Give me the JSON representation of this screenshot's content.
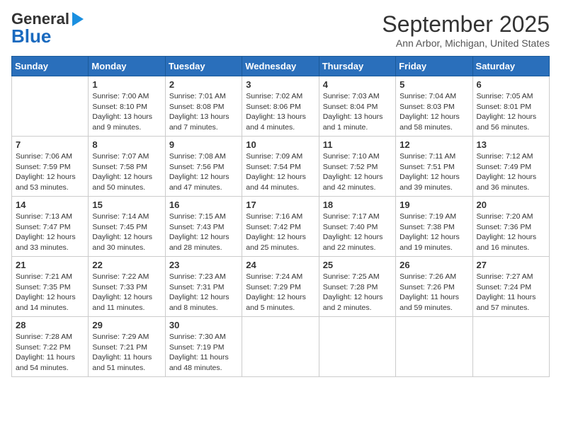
{
  "logo": {
    "line1": "General",
    "line2": "Blue"
  },
  "title": "September 2025",
  "subtitle": "Ann Arbor, Michigan, United States",
  "days_of_week": [
    "Sunday",
    "Monday",
    "Tuesday",
    "Wednesday",
    "Thursday",
    "Friday",
    "Saturday"
  ],
  "weeks": [
    [
      {
        "num": "",
        "info": ""
      },
      {
        "num": "1",
        "info": "Sunrise: 7:00 AM\nSunset: 8:10 PM\nDaylight: 13 hours\nand 9 minutes."
      },
      {
        "num": "2",
        "info": "Sunrise: 7:01 AM\nSunset: 8:08 PM\nDaylight: 13 hours\nand 7 minutes."
      },
      {
        "num": "3",
        "info": "Sunrise: 7:02 AM\nSunset: 8:06 PM\nDaylight: 13 hours\nand 4 minutes."
      },
      {
        "num": "4",
        "info": "Sunrise: 7:03 AM\nSunset: 8:04 PM\nDaylight: 13 hours\nand 1 minute."
      },
      {
        "num": "5",
        "info": "Sunrise: 7:04 AM\nSunset: 8:03 PM\nDaylight: 12 hours\nand 58 minutes."
      },
      {
        "num": "6",
        "info": "Sunrise: 7:05 AM\nSunset: 8:01 PM\nDaylight: 12 hours\nand 56 minutes."
      }
    ],
    [
      {
        "num": "7",
        "info": "Sunrise: 7:06 AM\nSunset: 7:59 PM\nDaylight: 12 hours\nand 53 minutes."
      },
      {
        "num": "8",
        "info": "Sunrise: 7:07 AM\nSunset: 7:58 PM\nDaylight: 12 hours\nand 50 minutes."
      },
      {
        "num": "9",
        "info": "Sunrise: 7:08 AM\nSunset: 7:56 PM\nDaylight: 12 hours\nand 47 minutes."
      },
      {
        "num": "10",
        "info": "Sunrise: 7:09 AM\nSunset: 7:54 PM\nDaylight: 12 hours\nand 44 minutes."
      },
      {
        "num": "11",
        "info": "Sunrise: 7:10 AM\nSunset: 7:52 PM\nDaylight: 12 hours\nand 42 minutes."
      },
      {
        "num": "12",
        "info": "Sunrise: 7:11 AM\nSunset: 7:51 PM\nDaylight: 12 hours\nand 39 minutes."
      },
      {
        "num": "13",
        "info": "Sunrise: 7:12 AM\nSunset: 7:49 PM\nDaylight: 12 hours\nand 36 minutes."
      }
    ],
    [
      {
        "num": "14",
        "info": "Sunrise: 7:13 AM\nSunset: 7:47 PM\nDaylight: 12 hours\nand 33 minutes."
      },
      {
        "num": "15",
        "info": "Sunrise: 7:14 AM\nSunset: 7:45 PM\nDaylight: 12 hours\nand 30 minutes."
      },
      {
        "num": "16",
        "info": "Sunrise: 7:15 AM\nSunset: 7:43 PM\nDaylight: 12 hours\nand 28 minutes."
      },
      {
        "num": "17",
        "info": "Sunrise: 7:16 AM\nSunset: 7:42 PM\nDaylight: 12 hours\nand 25 minutes."
      },
      {
        "num": "18",
        "info": "Sunrise: 7:17 AM\nSunset: 7:40 PM\nDaylight: 12 hours\nand 22 minutes."
      },
      {
        "num": "19",
        "info": "Sunrise: 7:19 AM\nSunset: 7:38 PM\nDaylight: 12 hours\nand 19 minutes."
      },
      {
        "num": "20",
        "info": "Sunrise: 7:20 AM\nSunset: 7:36 PM\nDaylight: 12 hours\nand 16 minutes."
      }
    ],
    [
      {
        "num": "21",
        "info": "Sunrise: 7:21 AM\nSunset: 7:35 PM\nDaylight: 12 hours\nand 14 minutes."
      },
      {
        "num": "22",
        "info": "Sunrise: 7:22 AM\nSunset: 7:33 PM\nDaylight: 12 hours\nand 11 minutes."
      },
      {
        "num": "23",
        "info": "Sunrise: 7:23 AM\nSunset: 7:31 PM\nDaylight: 12 hours\nand 8 minutes."
      },
      {
        "num": "24",
        "info": "Sunrise: 7:24 AM\nSunset: 7:29 PM\nDaylight: 12 hours\nand 5 minutes."
      },
      {
        "num": "25",
        "info": "Sunrise: 7:25 AM\nSunset: 7:28 PM\nDaylight: 12 hours\nand 2 minutes."
      },
      {
        "num": "26",
        "info": "Sunrise: 7:26 AM\nSunset: 7:26 PM\nDaylight: 11 hours\nand 59 minutes."
      },
      {
        "num": "27",
        "info": "Sunrise: 7:27 AM\nSunset: 7:24 PM\nDaylight: 11 hours\nand 57 minutes."
      }
    ],
    [
      {
        "num": "28",
        "info": "Sunrise: 7:28 AM\nSunset: 7:22 PM\nDaylight: 11 hours\nand 54 minutes."
      },
      {
        "num": "29",
        "info": "Sunrise: 7:29 AM\nSunset: 7:21 PM\nDaylight: 11 hours\nand 51 minutes."
      },
      {
        "num": "30",
        "info": "Sunrise: 7:30 AM\nSunset: 7:19 PM\nDaylight: 11 hours\nand 48 minutes."
      },
      {
        "num": "",
        "info": ""
      },
      {
        "num": "",
        "info": ""
      },
      {
        "num": "",
        "info": ""
      },
      {
        "num": "",
        "info": ""
      }
    ]
  ]
}
